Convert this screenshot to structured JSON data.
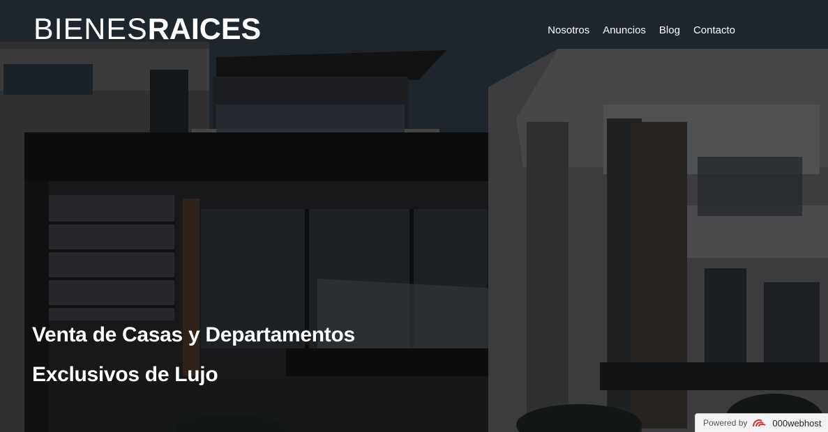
{
  "header": {
    "logo_light": "BIENES",
    "logo_bold": "RAICES",
    "nav": [
      "Nosotros",
      "Anuncios",
      "Blog",
      "Contacto"
    ]
  },
  "hero": {
    "line1": "Venta de Casas y Departamentos",
    "line2": "Exclusivos de Lujo",
    "background": "modern-house-photo"
  },
  "footer_badge": {
    "powered_by": "Powered by",
    "brand": "000webhost",
    "icon": "000webhost-logo-icon"
  },
  "colors": {
    "overlay": "#000000",
    "text": "#ffffff",
    "brand_red": "#e32a2a"
  }
}
